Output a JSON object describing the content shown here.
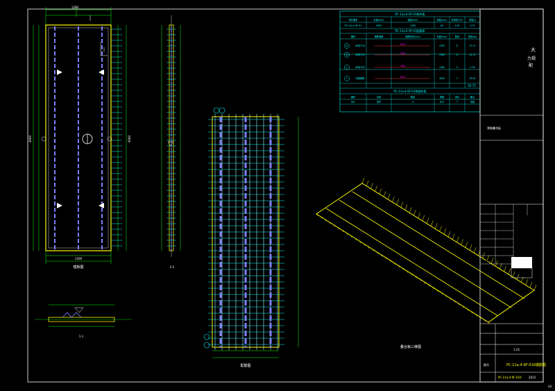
{
  "sheet": {
    "drawing_no": "PC-11a-4-9F-016",
    "drawing_title": "PC-11a-4-9F-01钢筋图",
    "scale": "1:25",
    "date": "2023",
    "label_left_bottom": "A2",
    "designer_label": "设计",
    "checker_label": "复核",
    "approve_label": "审核",
    "stage_label": "阶段",
    "version_label": "版本"
  },
  "title_block": {
    "company_line1": "大",
    "company_line2": "力规",
    "company_line3": "配",
    "project_label": "预制叠合板",
    "rows": [
      "会签",
      "专业",
      "建筑",
      "结构",
      "给排水",
      "电气",
      "暖通"
    ],
    "cols": [
      "签名",
      "日期"
    ],
    "note": "PC构件深化设计",
    "sheet_label": "图号",
    "sheet_value": "PC-11a-4-9F-016钢筋图",
    "page_mark": "A2"
  },
  "views": {
    "plan_title": "模板图",
    "plan_width": "1200",
    "plan_height": "4000",
    "section_22": "2-2",
    "section_11": "1-1",
    "rebar_title": "配筋图",
    "axo_title": "叠合板三维图"
  },
  "tables": {
    "t1_title": "PC-11a-4-9F-01构件表",
    "t1_headers": [
      "构件编号",
      "长度(mm)",
      "宽度(mm)",
      "厚度(mm)",
      "砼体积(m³)",
      "重量(t)"
    ],
    "t1_row": [
      "PC-11a-4-9F-01",
      "4000",
      "1200",
      "60",
      "0.29",
      "0.72"
    ],
    "t2_title": "PC-11a-4-9F-01配筋表",
    "t2_headers": [
      "编号",
      "钢筋规格",
      "钢筋形状(mm)",
      "长度(mm)",
      "数量",
      "重量(kg)"
    ],
    "t2_rows": [
      {
        "id": "1a",
        "spec": "Φ8@150",
        "len": "4180",
        "n": "8",
        "w": "13.21"
      },
      {
        "id": "1b",
        "spec": "Φ8@200",
        "len": "1380",
        "n": "27",
        "w": "14.72"
      },
      {
        "id": "2",
        "spec": "Φ6@200",
        "len": "1380",
        "n": "9",
        "w": "2.76"
      },
      {
        "id": "3",
        "spec": "桁架钢筋",
        "len": "4000",
        "n": "3",
        "w": "26.04"
      }
    ],
    "t2_total": "56.73",
    "t3_title": "PC-11a-4-9F-01预埋件表",
    "t3_headers": [
      "编号",
      "名称",
      "数量",
      "规格",
      "单位",
      "备注"
    ],
    "t3_row": [
      "MJ1",
      "吊环",
      "4",
      "Φ10",
      "个",
      "吊装"
    ]
  }
}
